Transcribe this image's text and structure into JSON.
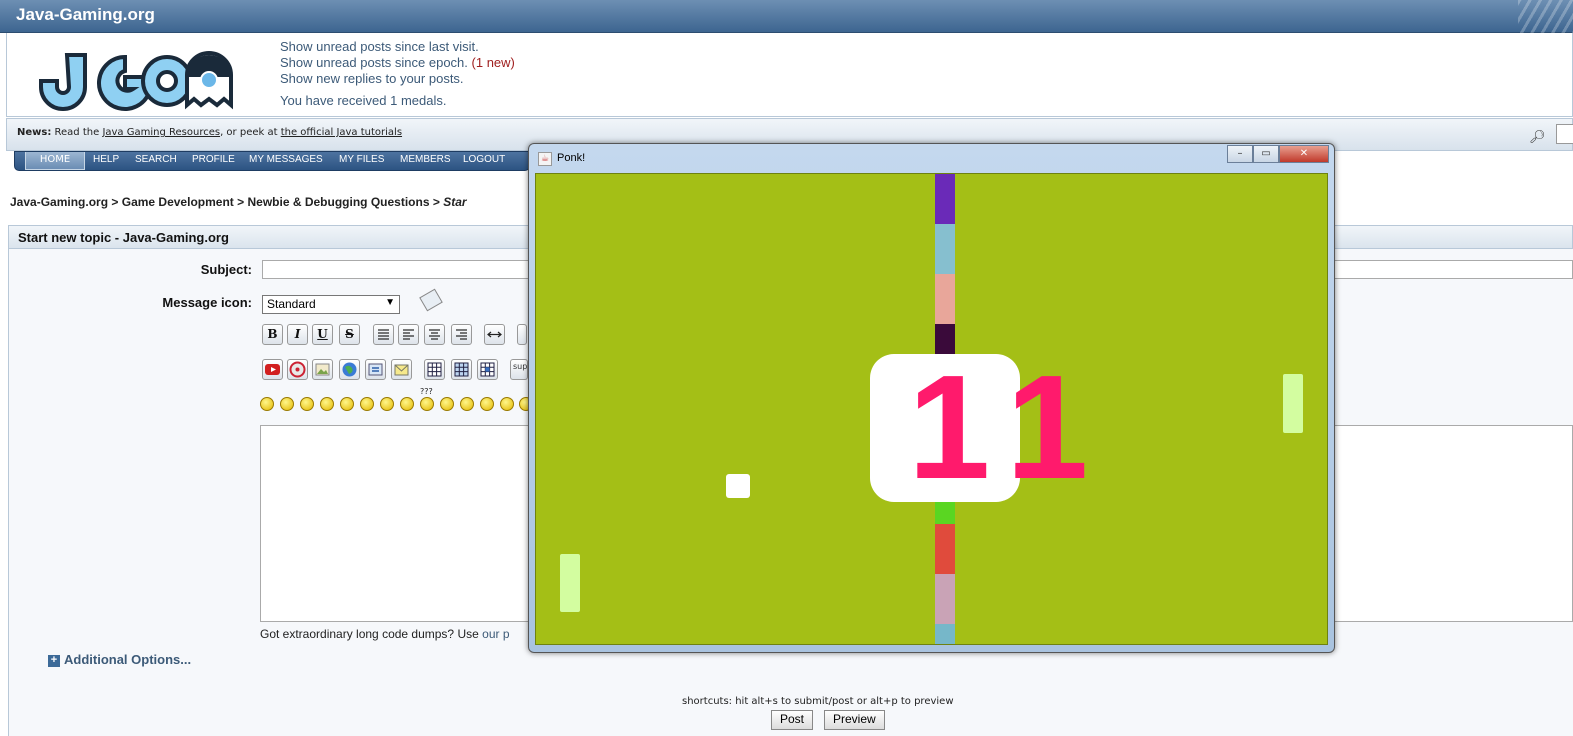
{
  "site": {
    "title": "Java-Gaming.org",
    "logo_text": "JGO"
  },
  "header": {
    "links": [
      "Show unread posts since last visit.",
      "Show unread posts since epoch.",
      "Show new replies to your posts."
    ],
    "new_badge": "(1 new)",
    "medals": "You have received 1 medals."
  },
  "news": {
    "label": "News:",
    "prefix": "Read the",
    "link1": "Java Gaming Resources",
    "middle": ", or peek at",
    "link2": "the official Java tutorials"
  },
  "nav": {
    "items": [
      "HOME",
      "HELP",
      "SEARCH",
      "PROFILE",
      "MY MESSAGES",
      "MY FILES",
      "MEMBERS",
      "LOGOUT"
    ]
  },
  "breadcrumb": {
    "parts": [
      "Java-Gaming.org",
      "Game Development",
      "Newbie & Debugging Questions"
    ],
    "current": "Star",
    "sep": ">"
  },
  "form": {
    "section_title": "Start new topic - Java-Gaming.org",
    "subject_label": "Subject:",
    "subject_value": "",
    "icon_label": "Message icon:",
    "icon_selected": "Standard",
    "toolbar1": [
      "B",
      "I",
      "U",
      "S"
    ],
    "sup_label": "sup",
    "smiley_tooltip": "???",
    "hint_text": "Got extraordinary long code dumps? Use",
    "hint_link": "our p",
    "additional_options": "Additional Options...",
    "shortcuts": "shortcuts: hit alt+s to submit/post or alt+p to preview",
    "post_button": "Post",
    "preview_button": "Preview"
  },
  "game_window": {
    "title": "Ponk!",
    "minimize": "▭",
    "restore": "▭",
    "close": "✕",
    "score_left": "1",
    "score_right": "1",
    "colors": {
      "court": "#a4bf16",
      "paddle": "#d3fda0",
      "score": "#ff1a6c",
      "net": [
        "#6a2ab8",
        "#86bfcf",
        "#e8a69a",
        "#3a0a3a",
        "#a4bf16",
        "#a4bf16",
        "#a4bf16",
        "#a4bf16",
        "#5ad622",
        "#e04b3c",
        "#c9a3b6",
        "#76b7c9"
      ]
    }
  }
}
